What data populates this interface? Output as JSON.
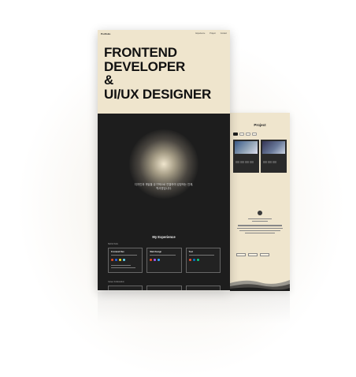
{
  "back_page": {
    "section_title": "Project",
    "filters": [
      "",
      "",
      "",
      ""
    ],
    "cards": [
      {
        "name": "",
        "tags": [
          "",
          "",
          "",
          ""
        ]
      },
      {
        "name": "",
        "tags": [
          "",
          "",
          ""
        ]
      }
    ],
    "contact_buttons": [
      "",
      "",
      ""
    ]
  },
  "front_page": {
    "logo": "Portfolio",
    "nav": [
      "Experience",
      "Project",
      "Contact"
    ],
    "headline": [
      "FRONTEND",
      "DEVELOPER",
      "&",
      "UI/UX DESIGNER"
    ],
    "intro": [
      "디자인과 개발을 유기적으로 연결하여 성장하는 인재,",
      "역사영입니다."
    ],
    "experience_title": "My Experience",
    "sections": [
      {
        "label": "Skill & Tools",
        "cards": [
          {
            "name": "Frontend Dev",
            "sub": "",
            "dot_colors": [
              "#e44d26",
              "#2965f1",
              "#f7df1e",
              "#61dafb"
            ]
          },
          {
            "name": "Web Design",
            "sub": "",
            "dot_colors": [
              "#f24e1e",
              "#a259ff",
              "#31a8ff"
            ]
          },
          {
            "name": "Tool",
            "sub": "",
            "dot_colors": [
              "#f05032",
              "#007acc",
              "#0acf83"
            ]
          }
        ]
      },
      {
        "label": "Career & Education",
        "cards": [
          {
            "name": "",
            "sub": "",
            "dot_colors": []
          },
          {
            "name": "",
            "sub": "",
            "dot_colors": []
          },
          {
            "name": "",
            "sub": "",
            "dot_colors": []
          }
        ]
      }
    ]
  },
  "colors": {
    "cream": "#efe5cd",
    "dark": "#1d1d1d",
    "card": "#222222"
  }
}
